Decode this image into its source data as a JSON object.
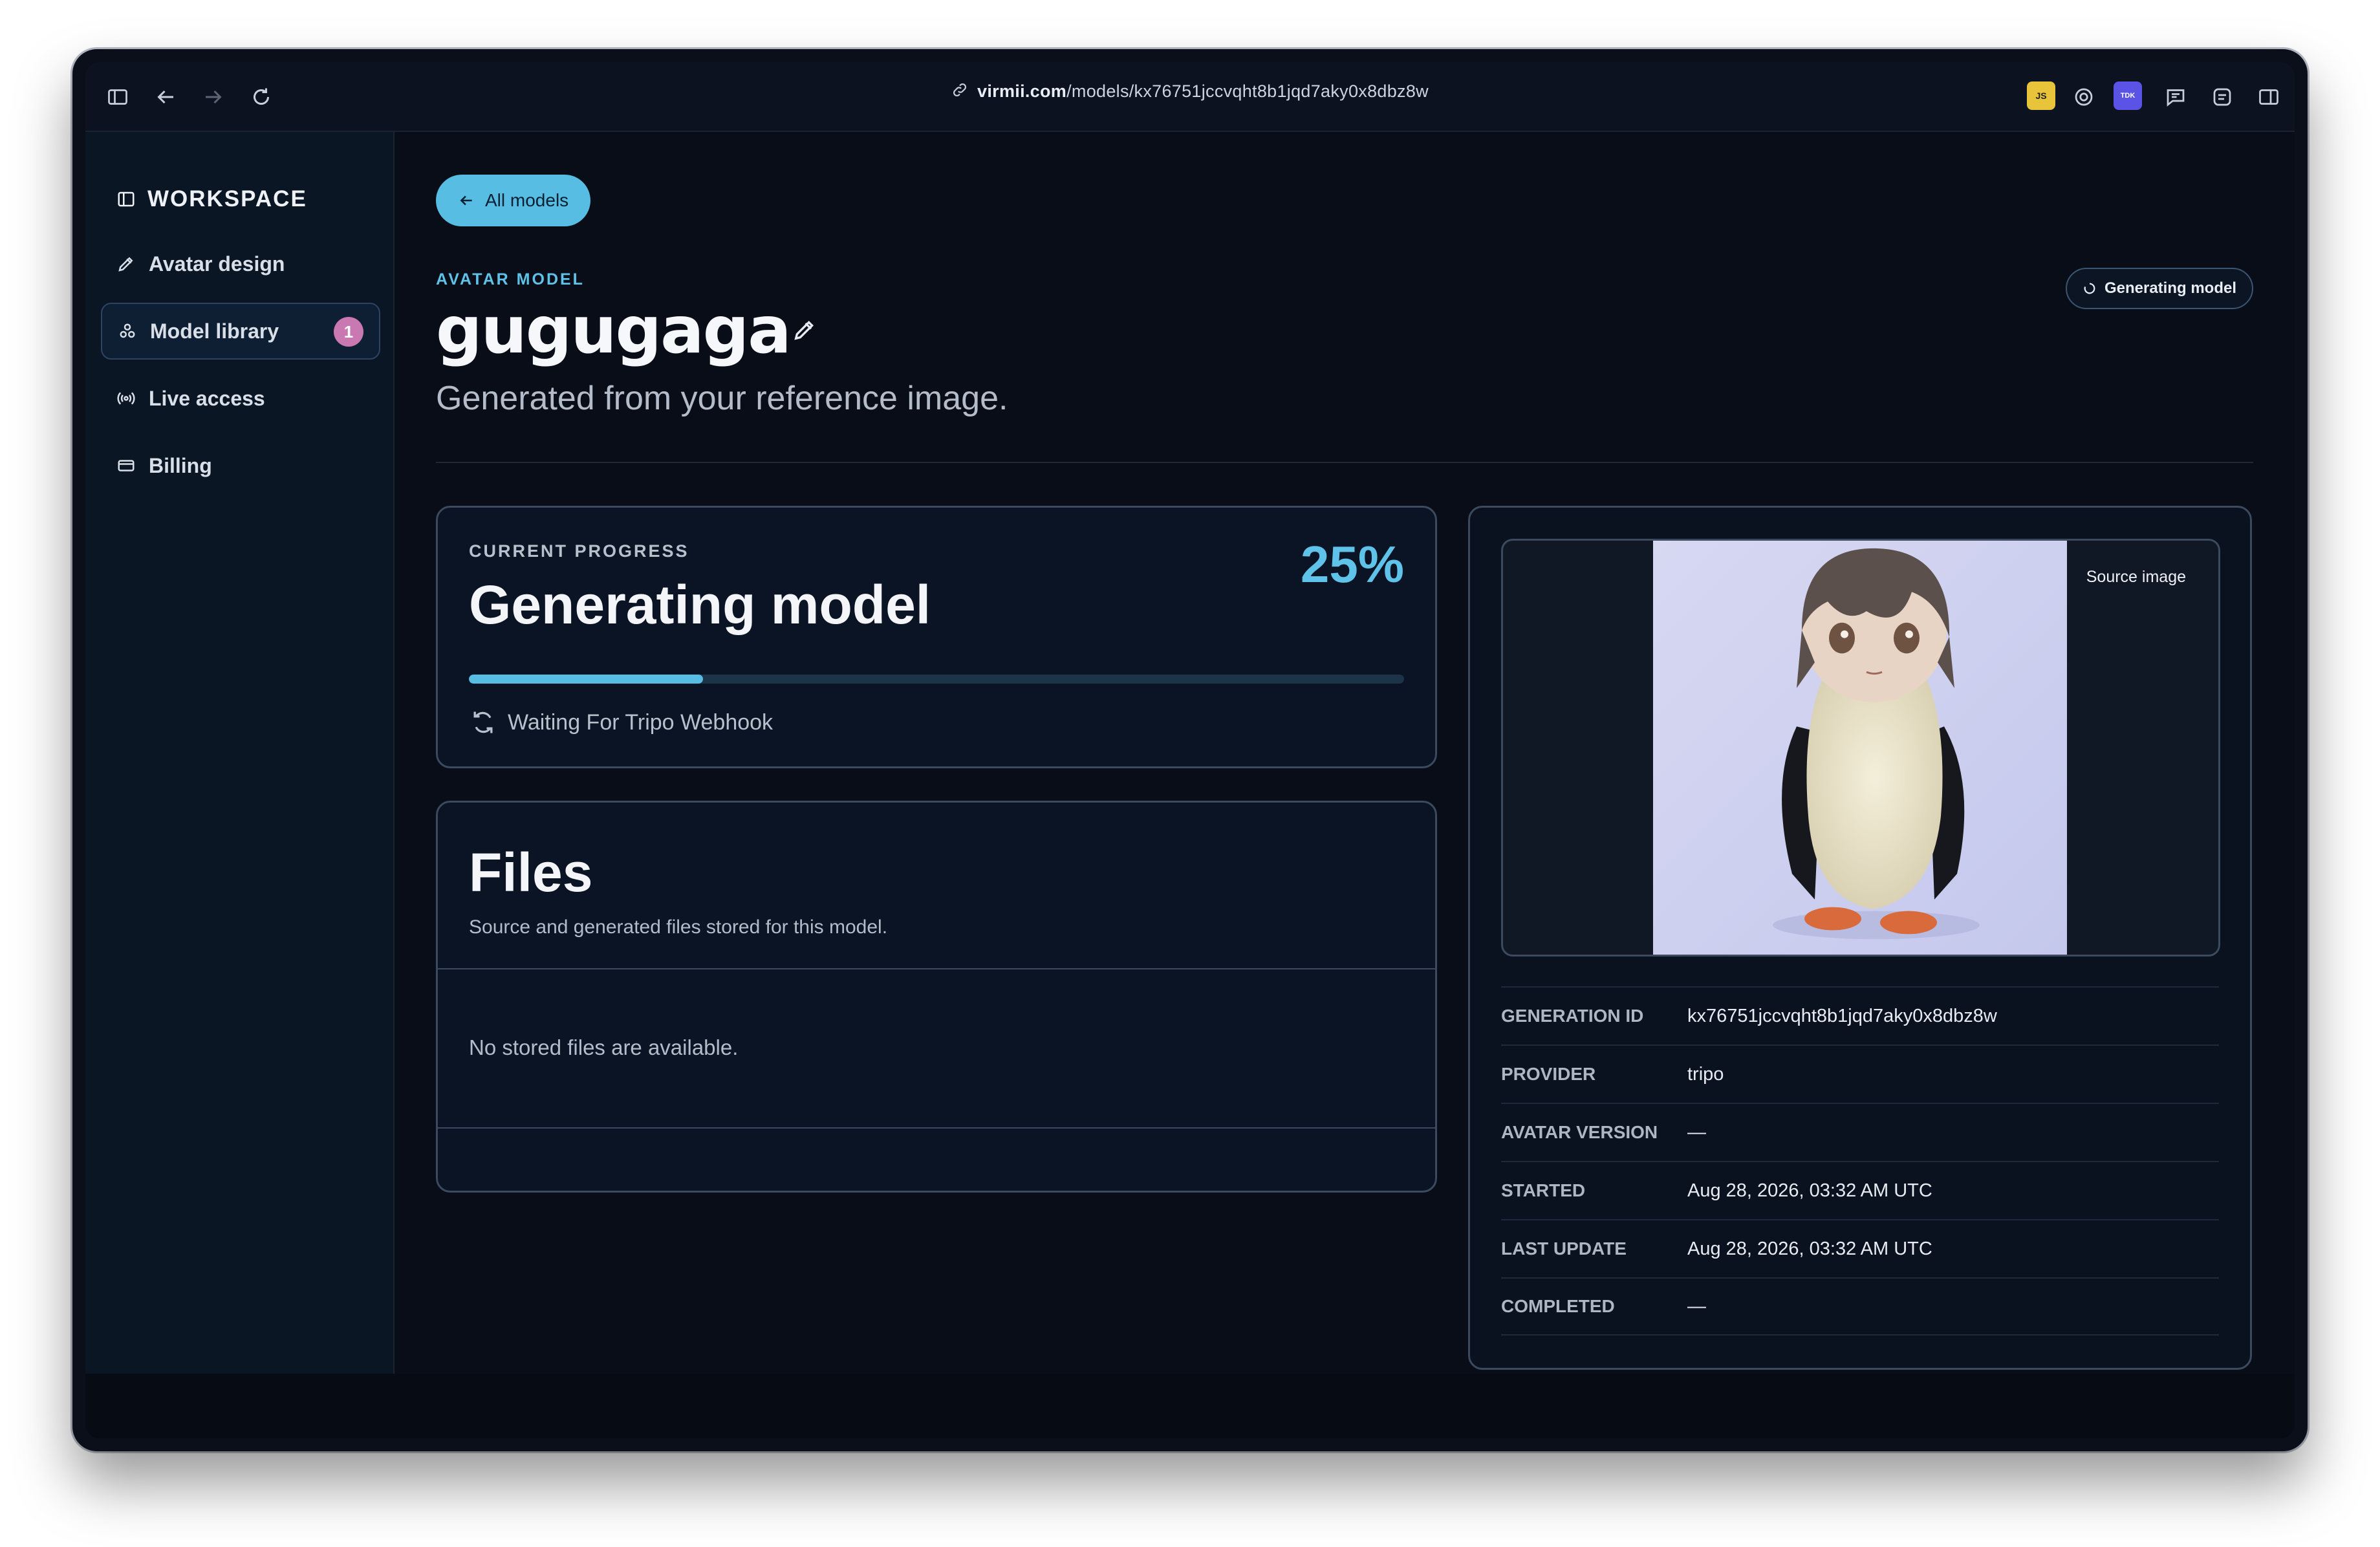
{
  "browser": {
    "url_domain": "virmii.com",
    "url_path": "/models/kx76751jccvqht8b1jqd7aky0x8dbz8w",
    "extensions": [
      "JS",
      "TDK"
    ]
  },
  "sidebar": {
    "workspace_title": "WORKSPACE",
    "items": [
      {
        "label": "Avatar design"
      },
      {
        "label": "Model library",
        "badge": "1"
      },
      {
        "label": "Live access"
      },
      {
        "label": "Billing"
      }
    ]
  },
  "header": {
    "back_label": "All models",
    "eyebrow": "AVATAR MODEL",
    "model_name": "gugugaga",
    "subtitle": "Generated from your reference image.",
    "status_pill": "Generating model"
  },
  "progress": {
    "label": "CURRENT PROGRESS",
    "title": "Generating model",
    "percent_text": "25%",
    "percent_value": 25,
    "status_text": "Waiting For Tripo Webhook"
  },
  "files": {
    "title": "Files",
    "subtitle": "Source and generated files stored for this model.",
    "empty_text": "No stored files are available."
  },
  "source": {
    "label": "Source image"
  },
  "meta": [
    {
      "key": "GENERATION ID",
      "value": "kx76751jccvqht8b1jqd7aky0x8dbz8w"
    },
    {
      "key": "PROVIDER",
      "value": "tripo"
    },
    {
      "key": "AVATAR VERSION",
      "value": "—"
    },
    {
      "key": "STARTED",
      "value": "Aug 28, 2026, 03:32 AM UTC"
    },
    {
      "key": "LAST UPDATE",
      "value": "Aug 28, 2026, 03:32 AM UTC"
    },
    {
      "key": "COMPLETED",
      "value": "—"
    }
  ],
  "colors": {
    "accent": "#58bde2",
    "badge": "#c978b1",
    "background": "#080d17"
  }
}
